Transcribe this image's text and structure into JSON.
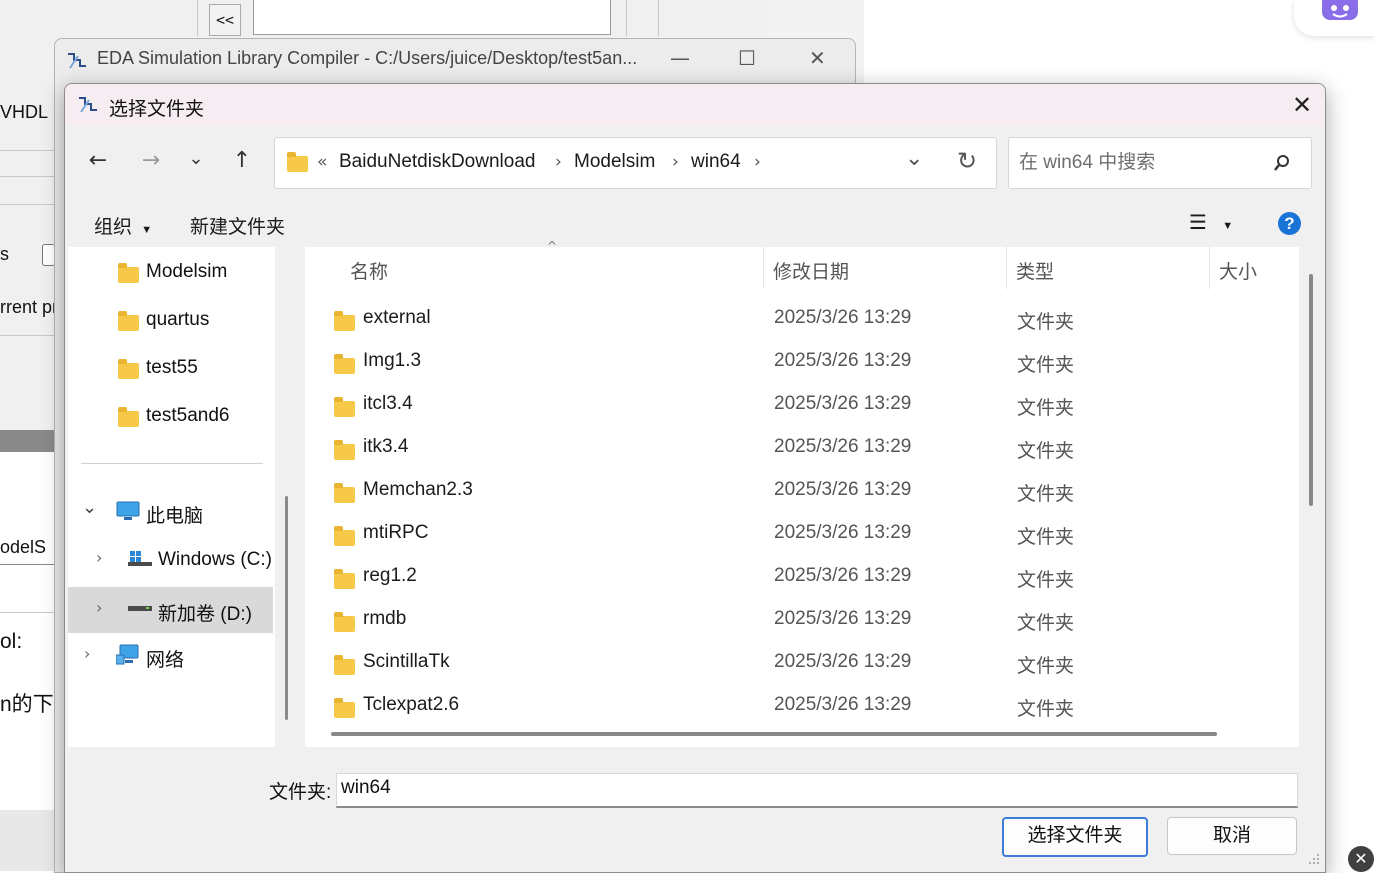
{
  "background_app": {
    "arrow_button": "<<",
    "vhdl_label": "VHDL",
    "s_label": "s",
    "current_label": "rrent pr",
    "model_label": "odelS",
    "tool_label": "ol:",
    "chinese_label": "n的下"
  },
  "eda_window": {
    "title": "EDA Simulation Library Compiler - C:/Users/juice/Desktop/test5an...",
    "minimize": "—",
    "maximize": "☐",
    "close": "✕"
  },
  "dialog": {
    "title": "选择文件夹",
    "close_glyph": "✕",
    "nav": {
      "back": "←",
      "forward": "→",
      "recent": "⌄",
      "up": "↑"
    },
    "address": {
      "overflow": "«",
      "crumbs": [
        "BaiduNetdiskDownload",
        "Modelsim",
        "win64"
      ],
      "sep": "›",
      "dropdown": "⌄",
      "refresh": "↻"
    },
    "search": {
      "placeholder": "在 win64 中搜索"
    },
    "toolbar": {
      "organize": "组织",
      "new_folder": "新建文件夹",
      "help": "?"
    },
    "nav_pane": {
      "quick": [
        "Modelsim",
        "quartus",
        "test55",
        "test5and6"
      ],
      "this_pc": "此电脑",
      "drives": [
        "Windows (C:)",
        "新加卷 (D:)"
      ],
      "network": "网络"
    },
    "columns": {
      "name": "名称",
      "date": "修改日期",
      "type": "类型",
      "size": "大小"
    },
    "rows": [
      {
        "name": "external",
        "date": "2025/3/26 13:29",
        "type": "文件夹"
      },
      {
        "name": "Img1.3",
        "date": "2025/3/26 13:29",
        "type": "文件夹"
      },
      {
        "name": "itcl3.4",
        "date": "2025/3/26 13:29",
        "type": "文件夹"
      },
      {
        "name": "itk3.4",
        "date": "2025/3/26 13:29",
        "type": "文件夹"
      },
      {
        "name": "Memchan2.3",
        "date": "2025/3/26 13:29",
        "type": "文件夹"
      },
      {
        "name": "mtiRPC",
        "date": "2025/3/26 13:29",
        "type": "文件夹"
      },
      {
        "name": "reg1.2",
        "date": "2025/3/26 13:29",
        "type": "文件夹"
      },
      {
        "name": "rmdb",
        "date": "2025/3/26 13:29",
        "type": "文件夹"
      },
      {
        "name": "ScintillaTk",
        "date": "2025/3/26 13:29",
        "type": "文件夹"
      },
      {
        "name": "Tclexpat2.6",
        "date": "2025/3/26 13:29",
        "type": "文件夹"
      }
    ],
    "folder_field": {
      "label": "文件夹:",
      "value": "win64"
    },
    "buttons": {
      "select": "选择文件夹",
      "cancel": "取消"
    }
  },
  "colors": {
    "title_bar": "#f6edf3",
    "selected_nav": "#d9d9d9",
    "primary_border": "#3c7bd6",
    "folder": "#f7c948",
    "help": "#1a73d6"
  }
}
